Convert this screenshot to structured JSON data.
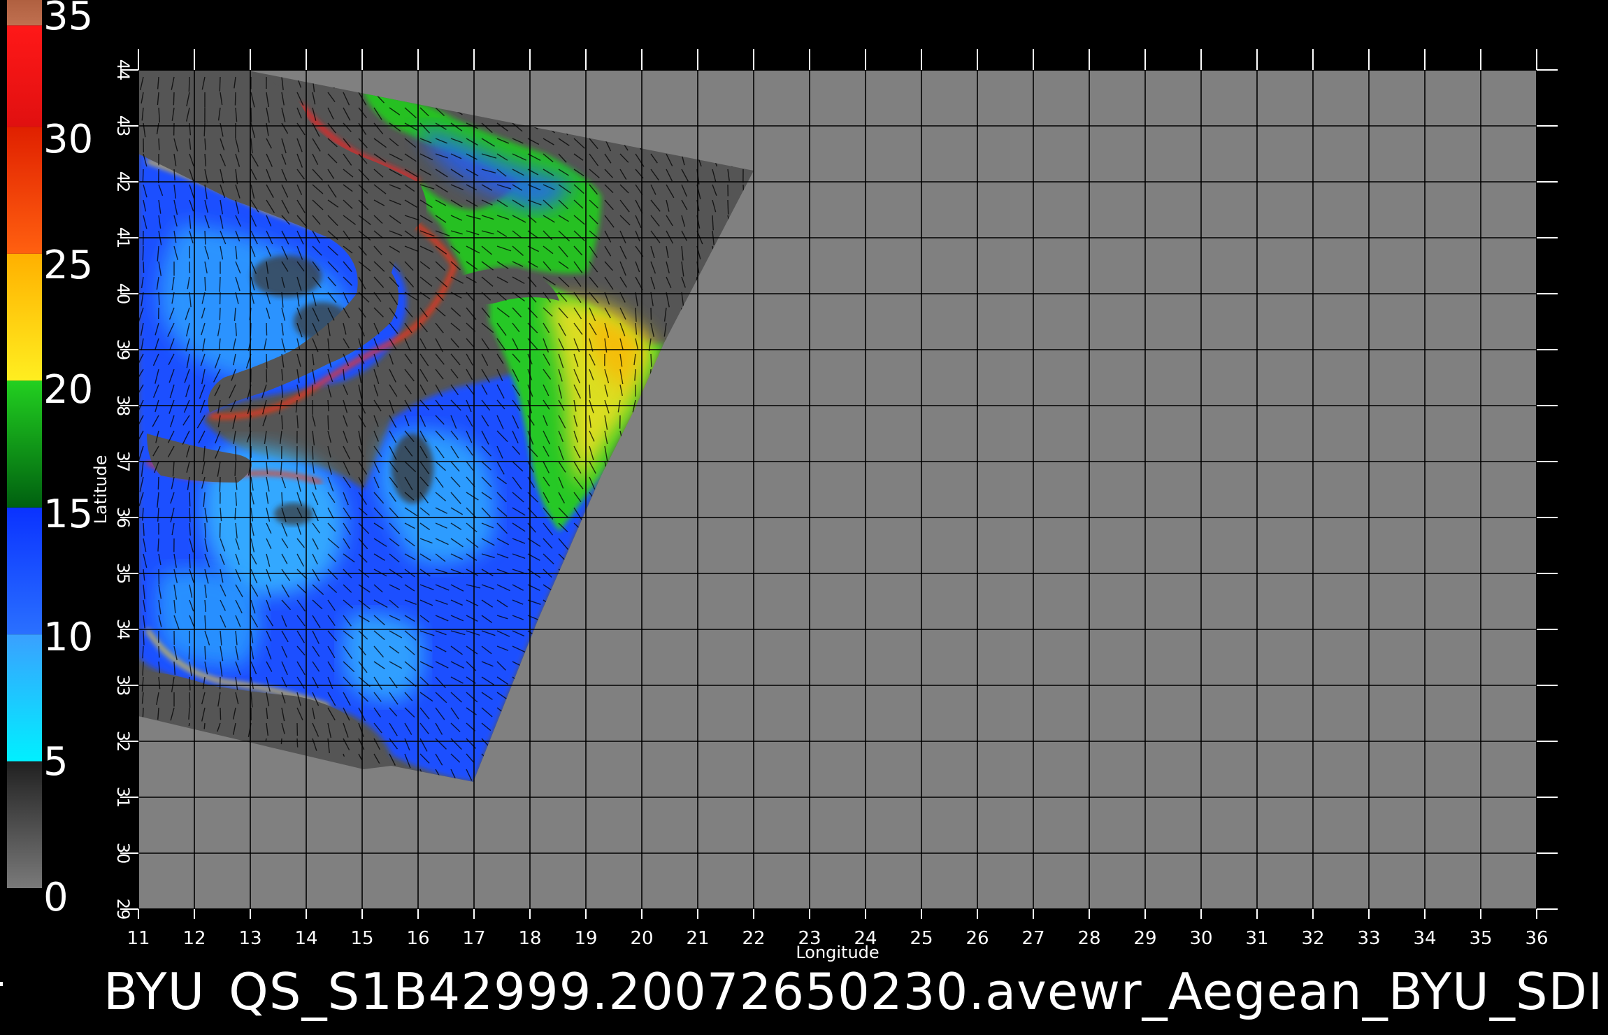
{
  "colorbar": {
    "ticks": [
      "35",
      "30",
      "25",
      "20",
      "15",
      "10",
      "5",
      "0"
    ],
    "stops": [
      {
        "from": 0,
        "to": 5,
        "colors": [
          "#7a7a7a",
          "#202020"
        ]
      },
      {
        "from": 5,
        "to": 10,
        "colors": [
          "#00f0ff",
          "#3aa0ff"
        ]
      },
      {
        "from": 10,
        "to": 15,
        "colors": [
          "#2a70ff",
          "#0a32ff"
        ]
      },
      {
        "from": 15,
        "to": 20,
        "colors": [
          "#006010",
          "#22d020"
        ]
      },
      {
        "from": 20,
        "to": 25,
        "colors": [
          "#ffee20",
          "#ffb000"
        ]
      },
      {
        "from": 25,
        "to": 30,
        "colors": [
          "#ff6010",
          "#e02000"
        ]
      },
      {
        "from": 30,
        "to": 34,
        "colors": [
          "#e01010",
          "#ff1818"
        ]
      },
      {
        "from": 34,
        "to": 35,
        "colors": [
          "#c07050",
          "#b06040"
        ]
      }
    ]
  },
  "map": {
    "x_label": "Longitude",
    "y_label": "Latitude",
    "lon_ticks": [
      "11",
      "12",
      "13",
      "14",
      "15",
      "16",
      "17",
      "18",
      "19",
      "20",
      "21",
      "22",
      "23",
      "24",
      "25",
      "26",
      "27",
      "28",
      "29",
      "30",
      "31",
      "32",
      "33",
      "34",
      "35",
      "36"
    ],
    "lat_ticks": [
      "29",
      "30",
      "31",
      "32",
      "33",
      "34",
      "35",
      "36",
      "37",
      "38",
      "39",
      "40",
      "41",
      "42",
      "43",
      "44"
    ],
    "lon_range": [
      11,
      36
    ],
    "lat_range": [
      29,
      44
    ],
    "grid": true,
    "background_color": "#808080",
    "swath_background": "#555555",
    "grid_color": "#000000"
  },
  "caption": {
    "institution": "BYU",
    "filename": "QS_S1B42999.20072650230.avewr_Aegean_BYU_SDI"
  }
}
